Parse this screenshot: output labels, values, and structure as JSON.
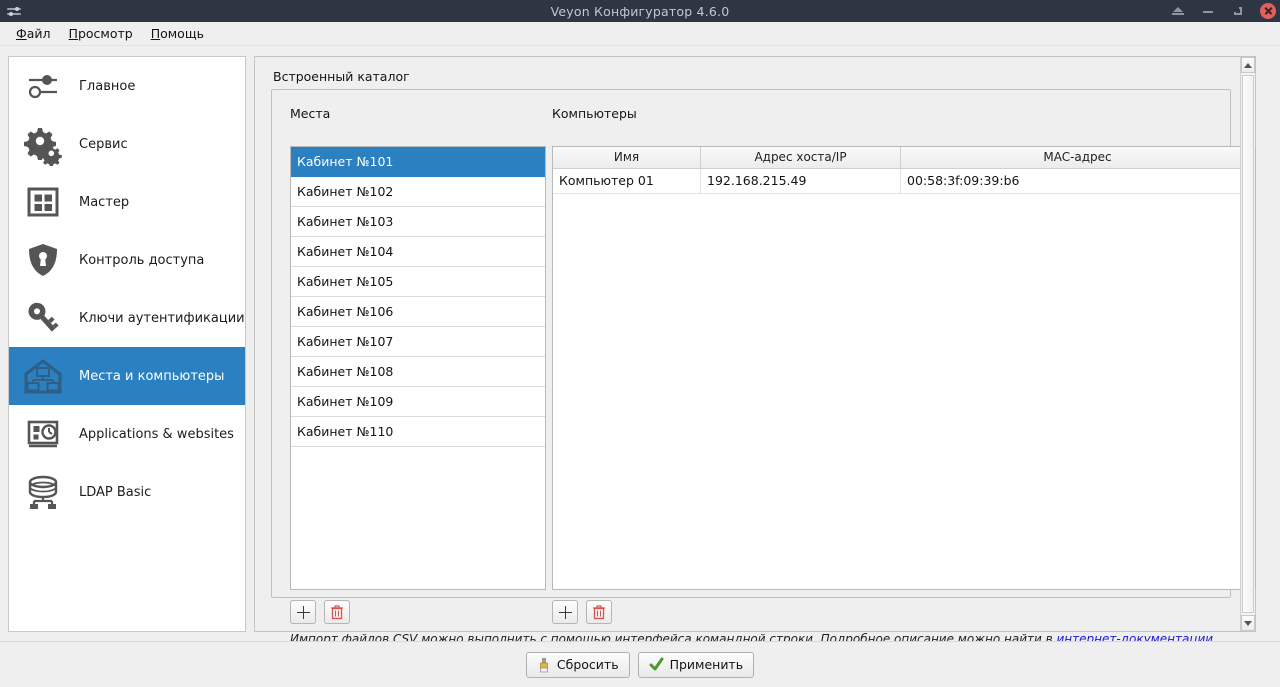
{
  "window": {
    "title": "Veyon Конфигуратор 4.6.0",
    "icon": "sliders-icon",
    "controls": [
      {
        "name": "shade-button",
        "icon": "shade-icon"
      },
      {
        "name": "minimize-button",
        "icon": "minimize-icon"
      },
      {
        "name": "maximize-button",
        "icon": "maximize-icon"
      },
      {
        "name": "close-button",
        "icon": "close-icon"
      }
    ],
    "colors": {
      "titlebar_bg": "#2f3643",
      "titlebar_text": "#c2c8d2",
      "accent_blue": "#2a80c0",
      "close_red": "#e06060",
      "link_blue": "#1a1ad0",
      "panel_bg": "#efefef"
    }
  },
  "menubar": {
    "items": [
      {
        "mnemonic": "Ф",
        "rest": "айл"
      },
      {
        "mnemonic": "П",
        "rest": "росмотр"
      },
      {
        "mnemonic": "П",
        "rest": "омощь"
      }
    ]
  },
  "sidebar": {
    "items": [
      {
        "label": "Главное",
        "icon": "sliders-icon",
        "selected": false
      },
      {
        "label": "Сервис",
        "icon": "gears-icon",
        "selected": false
      },
      {
        "label": "Мастер",
        "icon": "grid-window-icon",
        "selected": false
      },
      {
        "label": "Контроль доступа",
        "icon": "shield-keyhole-icon",
        "selected": false
      },
      {
        "label": "Ключи аутентификации",
        "icon": "key-icon",
        "selected": false
      },
      {
        "label": "Места и компьютеры",
        "icon": "house-network-icon",
        "selected": true
      },
      {
        "label": "Applications & websites",
        "icon": "monitor-clock-icon",
        "selected": false
      },
      {
        "label": "LDAP Basic",
        "icon": "database-network-icon",
        "selected": false
      }
    ]
  },
  "main": {
    "group_title": "Встроенный каталог",
    "places": {
      "label": "Места",
      "items": [
        "Кабинет №101",
        "Кабинет №102",
        "Кабинет №103",
        "Кабинет №104",
        "Кабинет №105",
        "Кабинет №106",
        "Кабинет №107",
        "Кабинет №108",
        "Кабинет №109",
        "Кабинет №110"
      ],
      "selected_index": 0,
      "add_button": {
        "name": "add-place-button",
        "icon": "plus-icon"
      },
      "delete_button": {
        "name": "delete-place-button",
        "icon": "trash-icon"
      }
    },
    "computers": {
      "label": "Компьютеры",
      "columns": [
        "Имя",
        "Адрес хоста/IP",
        "MAC-адрес"
      ],
      "rows": [
        {
          "name": "Компьютер 01",
          "host": "192.168.215.49",
          "mac": "00:58:3f:09:39:b6"
        }
      ],
      "add_button": {
        "name": "add-computer-button",
        "icon": "plus-icon"
      },
      "delete_button": {
        "name": "delete-computer-button",
        "icon": "trash-icon"
      }
    },
    "hint": {
      "before": "Импорт файлов CSV можно выполнить с помощью интерфейса командной строки. Подробное описание можно найти в ",
      "link": "интернет-документации",
      "after": "."
    }
  },
  "footer": {
    "reset_label": "Сбросить",
    "reset_icon": "brush-icon",
    "apply_label": "Применить",
    "apply_icon": "check-icon"
  }
}
